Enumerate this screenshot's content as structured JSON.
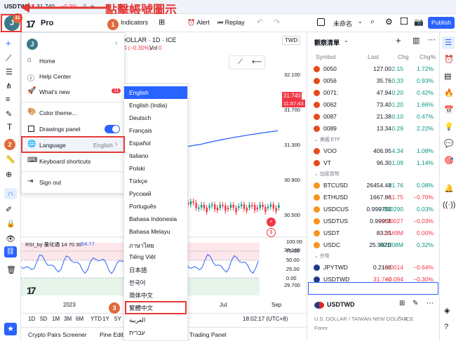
{
  "tab": {
    "symbol": "USDTWD",
    "arrow": "▼",
    "price": "31.740",
    "change": "−0.3%"
  },
  "annotation": {
    "title": "點擊帳號圖示",
    "step1": "1",
    "step2": "2",
    "step3": "3"
  },
  "toolbar": {
    "brand": "Pro",
    "indicators": "Indicators",
    "alert": "Alert",
    "replay": "Replay",
    "unnamed": "未命名",
    "publish": "Publish",
    "avatar_initial": "J",
    "avatar_badge": "11"
  },
  "chart": {
    "symbol_line": "DOLLAR · 1D · ICE",
    "change_line": "4 (−0.30%)",
    "vol_label": "Vol",
    "vol_value": "0",
    "currency": "TWD",
    "last_price": "31.740",
    "countdown": "11:57:43",
    "price_ticks": [
      "32.100",
      "31.700",
      "31.300",
      "30.900",
      "30.500",
      "30.100",
      "29.700"
    ],
    "rsi_label": "RSI_by 量化通 14 70 30",
    "rsi_value": "54.77",
    "rsi_ticks": [
      "100.00",
      "75.00",
      "50.00",
      "25.00",
      "0.00"
    ],
    "time_labels": [
      "2023",
      "Jul",
      "Sep"
    ],
    "ranges": [
      "1D",
      "5D",
      "1M",
      "3M",
      "6M",
      "YTD",
      "1Y",
      "5Y",
      "A"
    ],
    "clock": "18:02:17 (UTC+8)",
    "bottom_tabs": [
      "Crypto Pairs Screener",
      "Pine Editor",
      "Trading Panel"
    ]
  },
  "menu": {
    "header_initial": "J",
    "items": [
      {
        "label": "Home"
      },
      {
        "label": "Help Center"
      },
      {
        "label": "What's new",
        "badge": "11"
      },
      {
        "label": "Color theme..."
      },
      {
        "label": "Drawings panel"
      },
      {
        "label": "Language",
        "value": "English"
      },
      {
        "label": "Keyboard shortcuts"
      },
      {
        "label": "Sign out"
      }
    ]
  },
  "languages": [
    "English",
    "English (India)",
    "Deutsch",
    "Français",
    "Español",
    "Italiano",
    "Polski",
    "Türkçe",
    "Русский",
    "Português",
    "Bahasa Indonesia",
    "Bahasa Melayu",
    "ภาษาไทย",
    "Tiếng Việt",
    "日本語",
    "한국어",
    "简体中文",
    "繁體中文",
    "العربية",
    "עברית"
  ],
  "watchlist": {
    "title": "觀察清單",
    "headers": {
      "symbol": "Symbol",
      "last": "Last",
      "chg": "Chg",
      "chgp": "Chg%"
    },
    "groups": [
      {
        "name": "",
        "rows": [
          {
            "symbol": "0050",
            "last": "127.00",
            "chg": "2.15",
            "chgp": "1.72%",
            "dir": "up"
          },
          {
            "symbol": "0056",
            "last": "35.76",
            "chg": "0.33",
            "chgp": "0.93%",
            "dir": "up"
          },
          {
            "symbol": "0071:",
            "last": "47.94",
            "chg": "0.20",
            "chgp": "0.42%",
            "dir": "up"
          },
          {
            "symbol": "0062",
            "last": "73.40",
            "chg": "1.20",
            "chgp": "1.66%",
            "dir": "up"
          },
          {
            "symbol": "0087",
            "last": "21.38",
            "chg": "0.10",
            "chgp": "0.47%",
            "dir": "up"
          },
          {
            "symbol": "0089",
            "last": "13.34",
            "chg": "0.29",
            "chgp": "2.22%",
            "dir": "up"
          }
        ]
      },
      {
        "name": "美國 ETF",
        "rows": [
          {
            "symbol": "VOO",
            "last": "406.95",
            "chg": "4.34",
            "chgp": "1.08%",
            "dir": "up"
          },
          {
            "symbol": "VT",
            "last": "96.30",
            "chg": "1.09",
            "chgp": "1.14%",
            "dir": "up"
          }
        ]
      },
      {
        "name": "加密貨幣",
        "rows": [
          {
            "symbol": "BTCUSD",
            "last": "26454.48",
            "chg": "21.76",
            "chgp": "0.08%",
            "dir": "up"
          },
          {
            "symbol": "ETHUSD",
            "last": "1667.86",
            "chg": "−11.75",
            "chgp": "−0.70%",
            "dir": "down"
          },
          {
            "symbol": "USDCUS",
            "last": "0.999750",
            "chg": "0.000290",
            "chgp": "0.03%",
            "dir": "up"
          },
          {
            "symbol": "USDTUS",
            "last": "0.99958",
            "chg": "−0.00027",
            "chgp": "−0.03%",
            "dir": "down"
          },
          {
            "symbol": "USDT",
            "last": "83.35",
            "chg": "−1.169M",
            "chgp": "0.00%",
            "dir": "down"
          },
          {
            "symbol": "USDC",
            "last": "25.992B",
            "chg": "82.308M",
            "chgp": "0.32%",
            "dir": "up"
          }
        ]
      },
      {
        "name": "外幣",
        "rows": [
          {
            "symbol": "JPYTWD",
            "last": "0.2168",
            "chg": "−0.0014",
            "chgp": "−0.64%",
            "dir": "down"
          },
          {
            "symbol": "USDTWD",
            "last": "31.740",
            "chg": "−0.094",
            "chgp": "−0.30%",
            "dir": "down"
          }
        ]
      }
    ],
    "detail": {
      "symbol": "USDTWD",
      "desc": "U.S. DOLLAR / TAIWAN NEW DOLLAR",
      "exchange": "ICE",
      "type": "Forex"
    }
  },
  "colors": {
    "up": "#089981",
    "down": "#f23645",
    "accent": "#2962ff",
    "annotation": "#e53935"
  }
}
